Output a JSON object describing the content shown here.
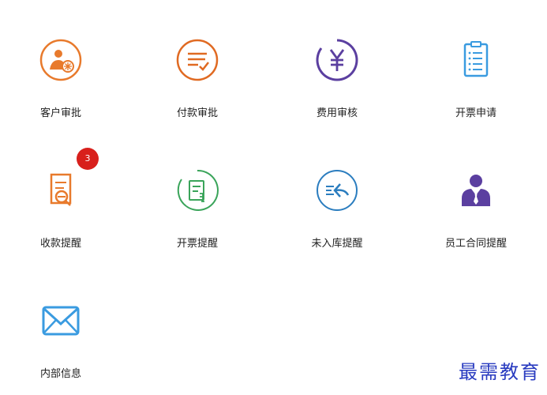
{
  "tiles": [
    {
      "label": "客户审批",
      "icon": "customer-approval-icon",
      "color": "#e87a2c"
    },
    {
      "label": "付款审批",
      "icon": "payment-approval-icon",
      "color": "#e06a22"
    },
    {
      "label": "费用审核",
      "icon": "expense-review-icon",
      "color": "#5b3fa0"
    },
    {
      "label": "开票申请",
      "icon": "invoice-request-icon",
      "color": "#3a9be0"
    },
    {
      "label": "收款提醒",
      "icon": "collection-reminder-icon",
      "color": "#e87a2c",
      "badge": "3"
    },
    {
      "label": "开票提醒",
      "icon": "invoice-reminder-icon",
      "color": "#3aa45a"
    },
    {
      "label": "未入库提醒",
      "icon": "not-stocked-reminder-icon",
      "color": "#2b7dbf"
    },
    {
      "label": "员工合同提醒",
      "icon": "employee-contract-reminder-icon",
      "color": "#5b3fa0"
    },
    {
      "label": "内部信息",
      "icon": "internal-message-icon",
      "color": "#3a9be0"
    }
  ],
  "watermark": "最需教育",
  "colors": {
    "badge": "#d8201c",
    "watermark": "#2a3cc0"
  }
}
